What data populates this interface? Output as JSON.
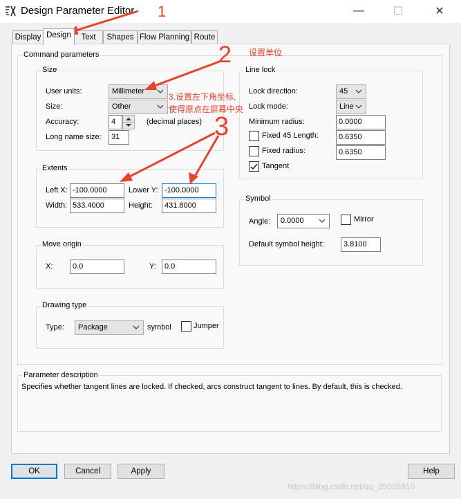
{
  "window": {
    "title": "Design Parameter Editor",
    "controls": {
      "minimize": "—",
      "maximize": "☐",
      "close": "✕"
    }
  },
  "tabs": [
    "Display",
    "Design",
    "Text",
    "Shapes",
    "Flow Planning",
    "Route"
  ],
  "command_parameters": {
    "title": "Command parameters",
    "size": {
      "title": "Size",
      "user_units_label": "User units:",
      "user_units_value": "Millimeter",
      "size_label": "Size:",
      "size_value": "Other",
      "accuracy_label": "Accuracy:",
      "accuracy_value": "4",
      "accuracy_hint": "(decimal places)",
      "long_name_label": "Long name size:",
      "long_name_value": "31"
    },
    "extents": {
      "title": "Extents",
      "left_x_label": "Left X:",
      "left_x_value": "-100.0000",
      "lower_y_label": "Lower Y:",
      "lower_y_value": "-100.0000",
      "width_label": "Width:",
      "width_value": "533.4000",
      "height_label": "Height:",
      "height_value": "431.8000"
    },
    "move_origin": {
      "title": "Move origin",
      "x_label": "X:",
      "x_value": "0.0",
      "y_label": "Y:",
      "y_value": "0.0"
    },
    "drawing_type": {
      "title": "Drawing type",
      "type_label": "Type:",
      "type_value": "Package",
      "symbol_label": "symbol",
      "jumper_label": "Jumper"
    },
    "line_lock": {
      "title": "Line lock",
      "lock_direction_label": "Lock direction:",
      "lock_direction_value": "45",
      "lock_mode_label": "Lock mode:",
      "lock_mode_value": "Line",
      "min_radius_label": "Minimum radius:",
      "min_radius_value": "0.0000",
      "fixed45_label": "Fixed 45 Length:",
      "fixed45_value": "0.6350",
      "fixed_radius_label": "Fixed radius:",
      "fixed_radius_value": "0.6350",
      "tangent_label": "Tangent",
      "tangent_checked": true
    },
    "symbol": {
      "title": "Symbol",
      "angle_label": "Angle:",
      "angle_value": "0.0000",
      "mirror_label": "Mirror",
      "default_height_label": "Default symbol height:",
      "default_height_value": "3.8100"
    }
  },
  "parameter_description": {
    "title": "Parameter description",
    "text": "Specifies whether tangent lines are locked. If checked, arcs construct tangent to lines. By default, this is checked."
  },
  "buttons": {
    "ok": "OK",
    "cancel": "Cancel",
    "apply": "Apply",
    "help": "Help"
  },
  "annotations": {
    "num1": "1",
    "num2": "2",
    "num3": "3",
    "note_units": "设置单位",
    "note_origin_line1": "3.设置左下角坐标,",
    "note_origin_line2": "使得原点在屏幕中央"
  },
  "watermark": "https://blog.csdn.net/qq_39035910",
  "colors": {
    "annotation": "#e8412c",
    "focus": "#0078d7"
  }
}
